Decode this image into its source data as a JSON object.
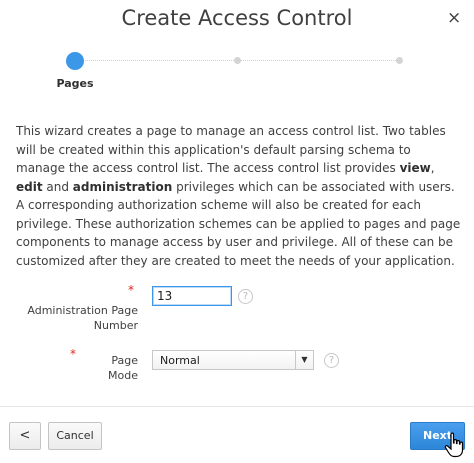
{
  "dialog": {
    "title": "Create Access Control",
    "close_glyph": "×"
  },
  "train": {
    "steps": [
      {
        "label": "Pages",
        "state": "active"
      },
      {
        "label": "",
        "state": "pending"
      },
      {
        "label": "",
        "state": "pending"
      }
    ]
  },
  "description": {
    "part1": "This wizard creates a page to manage an access control list. Two tables will be created within this application's default parsing schema to manage the access control list. The access control list provides ",
    "view": "view",
    "sep1": ", ",
    "edit": "edit",
    "sep2": " and ",
    "administration": "administration",
    "part2": " privileges which can be associated with users. A corresponding authorization scheme will also be created for each privilege. These authorization schemes can be applied to pages and page components to manage access by user and privilege. All of these can be customized after they are created to meet the needs of your application."
  },
  "form": {
    "required_mark": "*",
    "page_number_label_line1": "Administration Page",
    "page_number_label_line2": "Number",
    "page_number_value": "13",
    "page_mode_label": "Page Mode",
    "page_mode_value": "Normal",
    "help_glyph": "?"
  },
  "buttons": {
    "back_glyph": "<",
    "cancel": "Cancel",
    "next": "Next"
  },
  "colors": {
    "accent": "#3d97e8",
    "required": "#e0271b",
    "next_button": "#2d86d8"
  }
}
